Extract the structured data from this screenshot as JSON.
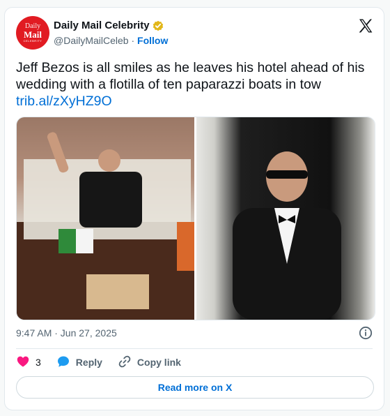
{
  "author": {
    "avatar_lines": [
      "Daily",
      "Mail",
      "CELEBRITY"
    ],
    "name": "Daily Mail Celebrity",
    "handle": "@DailyMailCeleb",
    "separator": "·",
    "follow_label": "Follow"
  },
  "post": {
    "text": "Jeff Bezos is all smiles as he leaves his hotel ahead of his wedding with a flotilla of ten paparazzi boats in tow",
    "link": "trib.al/zXyHZ9O",
    "time": "9:47 AM · Jun 27, 2025"
  },
  "actions": {
    "likes": "3",
    "reply_label": "Reply",
    "copy_label": "Copy link"
  },
  "read_more_label": "Read more on X",
  "colors": {
    "link": "#006fd6",
    "heart": "#f91880",
    "reply": "#1d9bf0",
    "brand": "#e11b22",
    "verified": "#e2b719"
  }
}
